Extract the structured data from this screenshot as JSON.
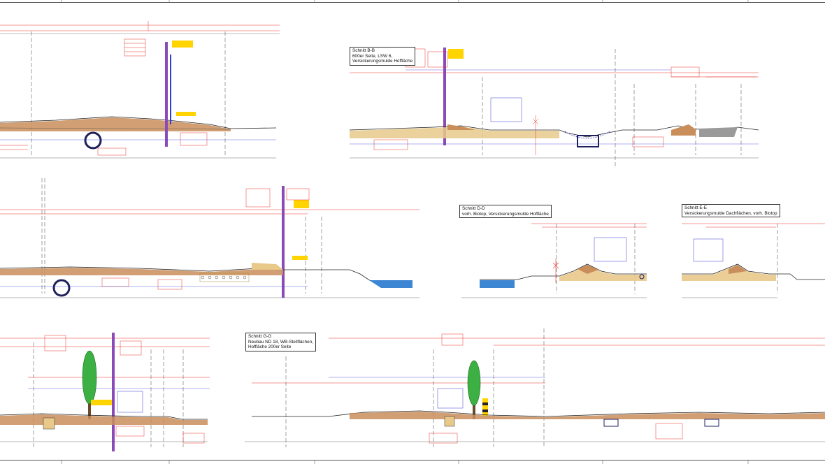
{
  "sections": [
    {
      "id": "B-B",
      "title": "Schnitt B-B",
      "lines": [
        "600er Seite, LSW 6,",
        "Versickerungsmulde Hoffläche"
      ]
    },
    {
      "id": "D-D",
      "title": "Schnitt D-D",
      "lines": [
        "vorh. Biotop, Versickerungsmulde Hoffläche"
      ]
    },
    {
      "id": "E-E",
      "title": "Schnitt E-E",
      "lines": [
        "Versickerungsmulde Dachflächen, vorh. Biotop"
      ]
    },
    {
      "id": "G-G",
      "title": "Schnitt G-G",
      "lines": [
        "Neubau ND 18, WB-Stellflächen,",
        "Hoffläche 200er Seite"
      ]
    }
  ],
  "colors": {
    "dimension": "#e8342a",
    "annotation_blue": "#3b3bd6",
    "ground_line": "#222222",
    "soil": "#c98e5a",
    "gravel": "#e8c98a",
    "pipe": "#1f1f5c",
    "water": "#3c86d4",
    "tree": "#3cb043",
    "label_yellow": "#ffd400",
    "pole": "#8a4bb8",
    "grey_fill": "#9a9a9a"
  },
  "icons": {
    "pipe": "circle-pipe-icon",
    "tree": "tree-icon",
    "pole": "pole-icon",
    "water": "water-basin-icon"
  }
}
